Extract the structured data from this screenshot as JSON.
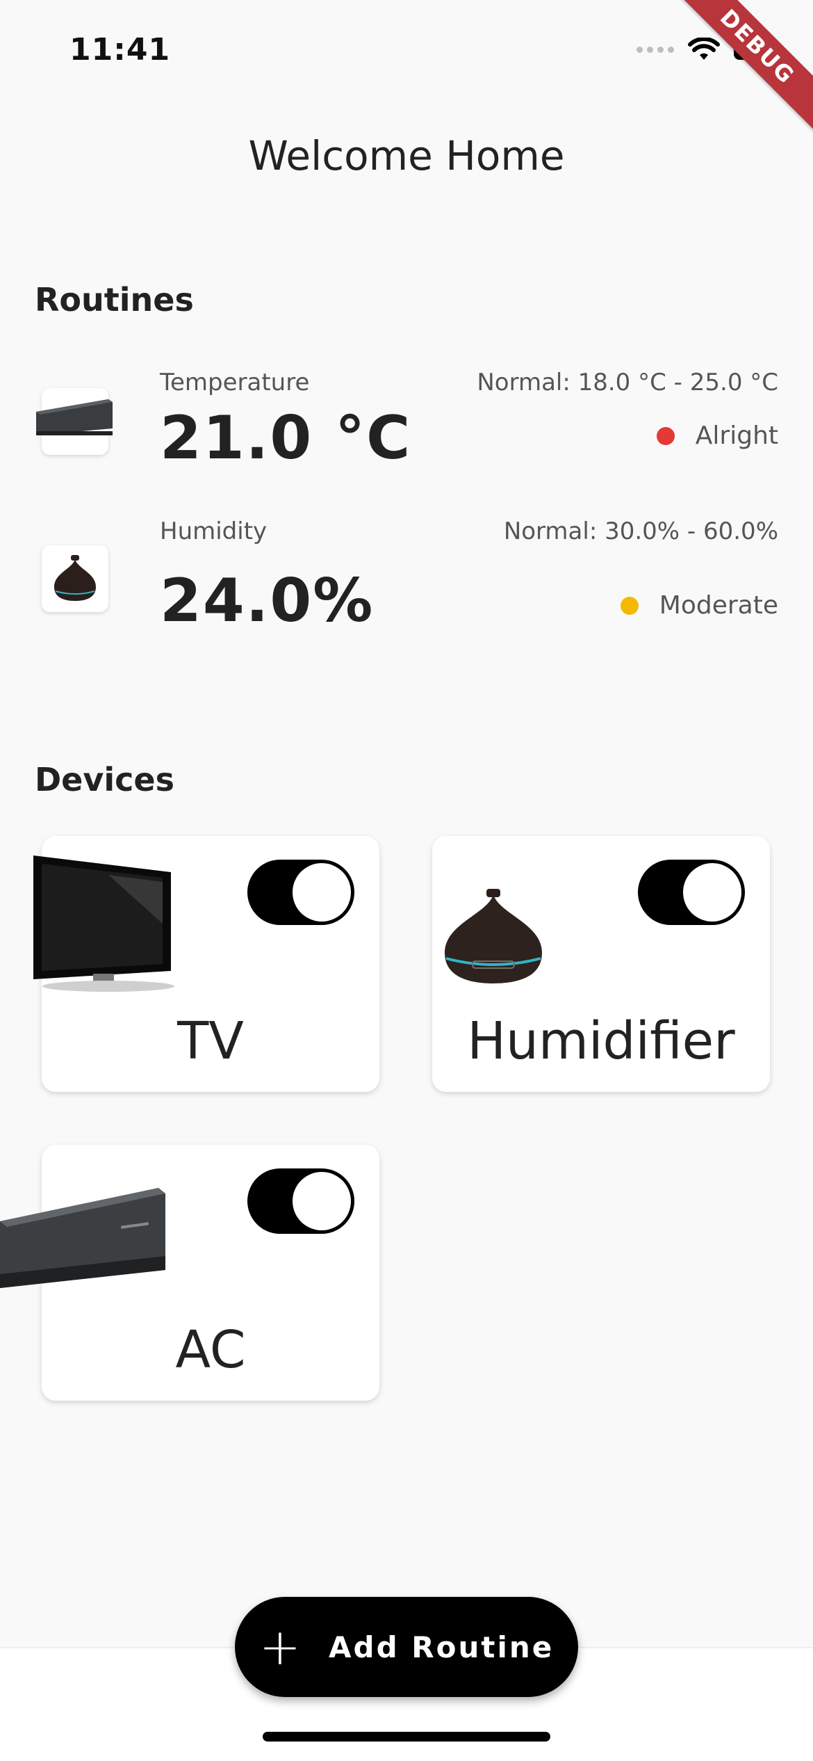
{
  "status_bar": {
    "time": "11:41"
  },
  "debug_banner": "DEBUG",
  "header": {
    "title": "Welcome Home"
  },
  "routines": {
    "title": "Routines",
    "items": [
      {
        "label": "Temperature",
        "value": "21.0 °C",
        "normal": "Normal:  18.0 °C - 25.0 °C",
        "status": "Alright",
        "status_color": "#e53935",
        "icon": "air-conditioner-icon"
      },
      {
        "label": "Humidity",
        "value": "24.0%",
        "normal": "Normal:  30.0% - 60.0%",
        "status": "Moderate",
        "status_color": "#f5b800",
        "icon": "humidifier-icon"
      }
    ]
  },
  "devices": {
    "title": "Devices",
    "items": [
      {
        "name": "TV",
        "on": true,
        "icon": "tv-icon"
      },
      {
        "name": "Humidifier",
        "on": true,
        "icon": "humidifier-icon"
      },
      {
        "name": "AC",
        "on": true,
        "icon": "air-conditioner-icon"
      }
    ]
  },
  "fab": {
    "label": "Add Routine",
    "icon": "plus-icon"
  }
}
